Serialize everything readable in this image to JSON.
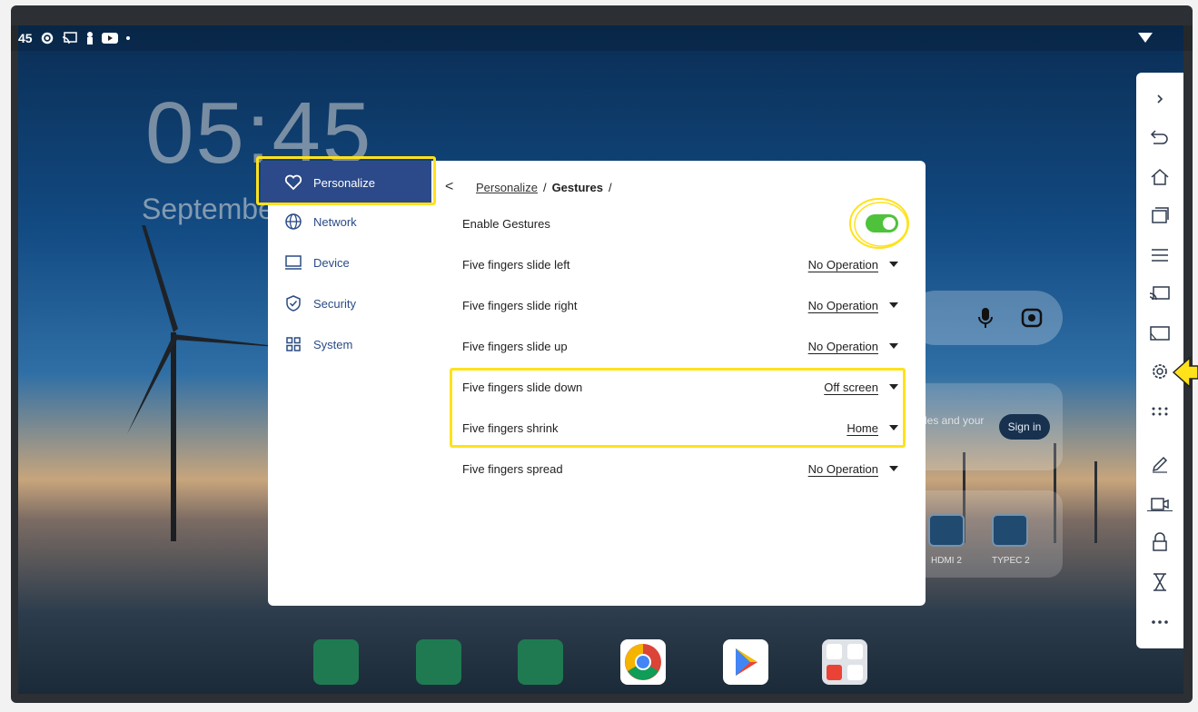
{
  "status_bar": {
    "time_fragment": "45",
    "icons": [
      "gear-icon",
      "cast-icon",
      "person-icon",
      "youtube-icon",
      "dot-icon"
    ]
  },
  "lockscreen": {
    "clock": "05:45",
    "date": "Septembe"
  },
  "background_widgets": {
    "search_icons": [
      "mic-icon",
      "lens-icon"
    ],
    "sign_in_text": "les and your",
    "sign_in_button": "Sign in",
    "sources": [
      "HDMI 2",
      "TYPEC 2"
    ]
  },
  "settings": {
    "nav": [
      {
        "label": "Personalize",
        "icon": "heart-icon",
        "active": true
      },
      {
        "label": "Network",
        "icon": "globe-icon",
        "active": false
      },
      {
        "label": "Device",
        "icon": "monitor-icon",
        "active": false
      },
      {
        "label": "Security",
        "icon": "shield-icon",
        "active": false
      },
      {
        "label": "System",
        "icon": "grid-icon",
        "active": false
      }
    ],
    "breadcrumb": {
      "back": "<",
      "parent": "Personalize",
      "sep1": "/",
      "current": "Gestures",
      "sep2": "/"
    },
    "rows": [
      {
        "label": "Enable Gestures",
        "type": "toggle",
        "on": true
      },
      {
        "label": "Five fingers slide left",
        "value": "No Operation"
      },
      {
        "label": "Five fingers slide right",
        "value": "No Operation"
      },
      {
        "label": "Five fingers slide up",
        "value": "No Operation"
      },
      {
        "label": "Five fingers slide down",
        "value": "Off screen"
      },
      {
        "label": "Five fingers shrink",
        "value": "Home"
      },
      {
        "label": "Five fingers spread",
        "value": "No Operation"
      }
    ]
  },
  "side_toolbar": {
    "buttons": [
      "chevron-right-icon",
      "back-icon",
      "home-icon",
      "recents-icon",
      "menu-icon",
      "cast-icon",
      "screen-icon",
      "gear-icon",
      "apps-icon",
      "pen-icon",
      "record-icon",
      "lock-icon",
      "timer-icon",
      "more-icon"
    ]
  },
  "dock": {
    "apps": [
      "whiteboard",
      "screen-share",
      "files",
      "chrome",
      "play-store",
      "google-apps"
    ]
  },
  "colors": {
    "nav_active_bg": "#2c4a8a",
    "nav_text": "#2a4b86",
    "toggle_on": "#4fc23b",
    "highlight": "#ffe21a"
  }
}
